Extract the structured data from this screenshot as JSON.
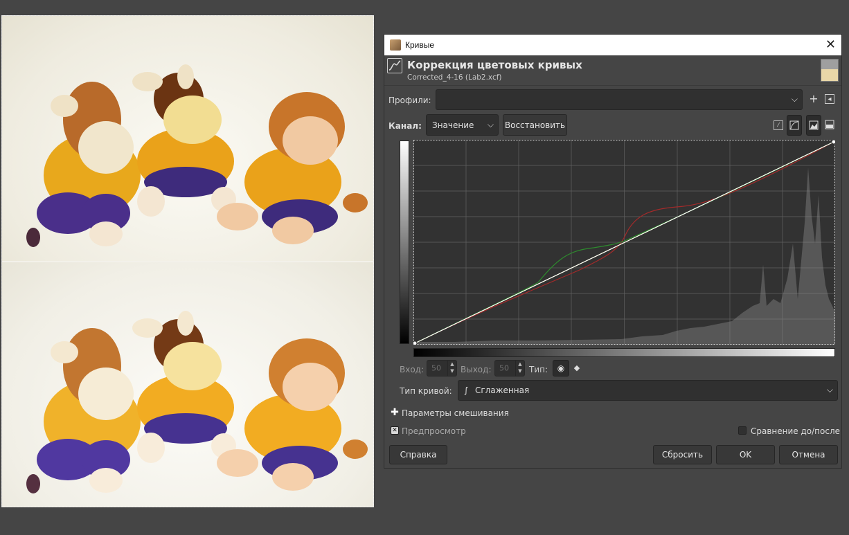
{
  "dialog": {
    "window_title": "Кривые",
    "header_title": "Коррекция цветовых кривых",
    "header_subtitle": "Corrected_4-16 (Lab2.xcf)"
  },
  "profiles": {
    "label": "Профили:",
    "value": ""
  },
  "channel": {
    "label": "Канал:",
    "value": "Значение",
    "reset_button": "Восстановить"
  },
  "point": {
    "input_label": "Вход:",
    "input_value": "50",
    "output_label": "Выход:",
    "output_value": "50",
    "type_label": "Тип:"
  },
  "curve_type": {
    "label": "Тип кривой:",
    "value": "Сглаженная"
  },
  "blending": {
    "label": "Параметры смешивания"
  },
  "preview": {
    "label": "Предпросмотр",
    "checked": true
  },
  "compare": {
    "label": "Сравнение до/после",
    "checked": false
  },
  "buttons": {
    "help": "Справка",
    "reset": "Сбросить",
    "ok": "OK",
    "cancel": "Отмена"
  },
  "curves": {
    "value_color": "#ffffff",
    "red_color": "#a52a2a",
    "green_color": "#2e8b2e",
    "yellow_color": "#c8c832"
  },
  "colors": {
    "panel_bg": "#454545",
    "graph_bg": "#323232",
    "histogram": "#5a5a5a"
  }
}
